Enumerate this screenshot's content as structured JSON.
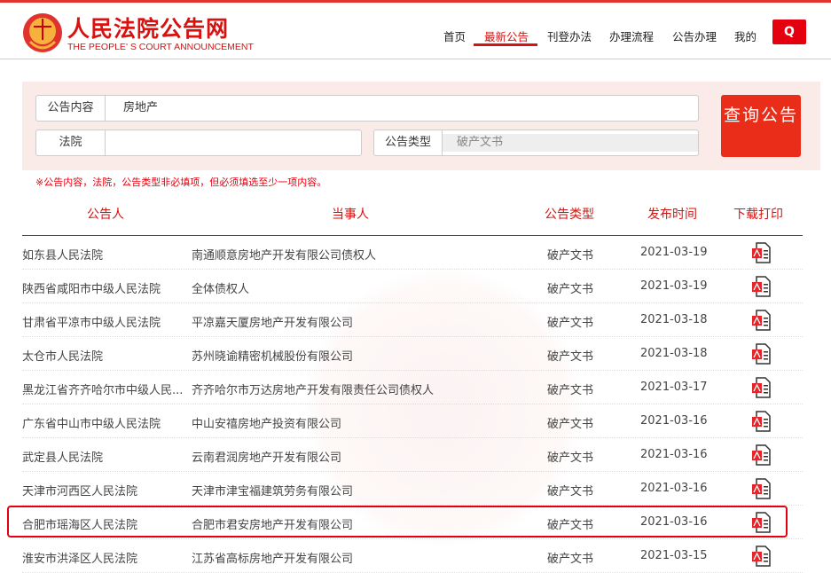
{
  "header": {
    "brand": "人民法院公告网",
    "brand_en": "THE PEOPLE' S COURT ANNOUNCEMENT",
    "nav": [
      "首页",
      "最新公告",
      "刊登办法",
      "办理流程",
      "公告办理",
      "我的"
    ],
    "active_nav": "最新公告",
    "search_icon": "Q"
  },
  "form": {
    "content_label": "公告内容",
    "content_value": "房地产",
    "court_label": "法院",
    "court_value": "",
    "type_label": "公告类型",
    "type_value": "破产文书",
    "submit": "查询公告",
    "note": "※公告内容，法院，公告类型非必填项，但必须填选至少一项内容。"
  },
  "table": {
    "headers": [
      "公告人",
      "当事人",
      "公告类型",
      "发布时间",
      "下载打印"
    ],
    "rows": [
      [
        "如东县人民法院",
        "南通顺意房地产开发有限公司债权人",
        "破产文书",
        "2021-03-19"
      ],
      [
        "陕西省咸阳市中级人民法院",
        "全体债权人",
        "破产文书",
        "2021-03-19"
      ],
      [
        "甘肃省平凉市中级人民法院",
        "平凉嘉天厦房地产开发有限公司",
        "破产文书",
        "2021-03-18"
      ],
      [
        "太仓市人民法院",
        "苏州晓谕精密机械股份有限公司",
        "破产文书",
        "2021-03-18"
      ],
      [
        "黑龙江省齐齐哈尔市中级人民...",
        "齐齐哈尔市万达房地产开发有限责任公司债权人",
        "破产文书",
        "2021-03-17"
      ],
      [
        "广东省中山市中级人民法院",
        "中山安禧房地产投资有限公司",
        "破产文书",
        "2021-03-16"
      ],
      [
        "武定县人民法院",
        "云南君润房地产开发有限公司",
        "破产文书",
        "2021-03-16"
      ],
      [
        "天津市河西区人民法院",
        "天津市津宝福建筑劳务有限公司",
        "破产文书",
        "2021-03-16"
      ],
      [
        "合肥市瑶海区人民法院",
        "合肥市君安房地产开发有限公司",
        "破产文书",
        "2021-03-16"
      ],
      [
        "淮安市洪泽区人民法院",
        "江苏省高标房地产开发有限公司",
        "破产文书",
        "2021-03-15"
      ]
    ]
  },
  "colors": {
    "accent": "#d7120f",
    "form_bg": "#fbebe8"
  }
}
